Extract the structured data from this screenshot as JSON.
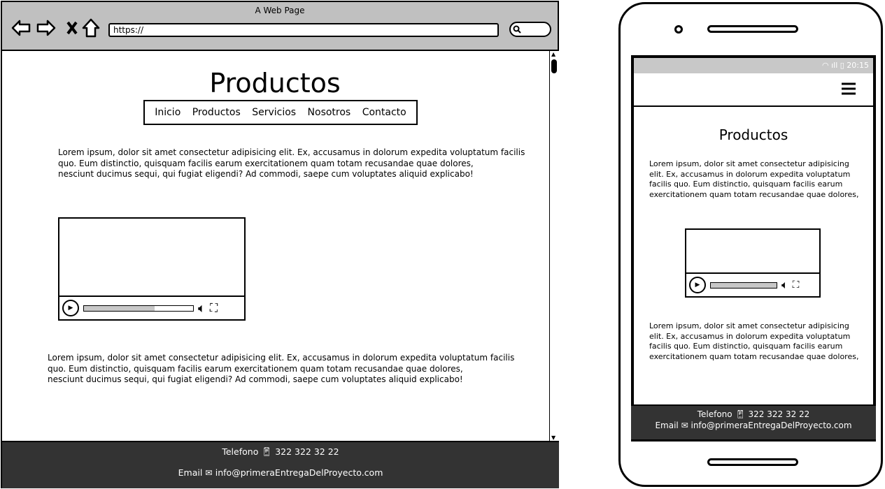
{
  "browser": {
    "title": "A Web Page",
    "url": "https://"
  },
  "page": {
    "heading": "Productos",
    "nav": [
      "Inicio",
      "Productos",
      "Servicios",
      "Nosotros",
      "Contacto"
    ],
    "paragraph1": [
      "Lorem ipsum, dolor sit amet consectetur adipisicing elit. Ex, accusamus in dolorum expedita voluptatum facilis",
      "quo. Eum distinctio, quisquam facilis earum exercitationem quam totam recusandae quae dolores,",
      "nesciunt ducimus sequi, qui fugiat eligendi? Ad commodi, saepe cum voluptates aliquid explicabo!"
    ],
    "paragraph2": [
      "Lorem ipsum, dolor sit amet consectetur adipisicing elit. Ex, accusamus in dolorum expedita voluptatum facilis",
      "quo. Eum distinctio, quisquam facilis earum exercitationem quam totam recusandae quae dolores,",
      "nesciunt ducimus sequi, qui fugiat eligendi? Ad commodi, saepe cum voluptates aliquid explicabo!"
    ],
    "video": {
      "progress": 0.65
    }
  },
  "footer": {
    "phone_label": "Telefono",
    "phone": "322 322 32 22",
    "email_label": "Email",
    "email": "info@primeraEntregaDelProyecto.com"
  },
  "mobile": {
    "time": "20:15",
    "heading": "Productos",
    "paragraph1": [
      "Lorem ipsum, dolor sit amet consectetur adipisicing",
      "elit. Ex, accusamus in dolorum expedita voluptatum",
      "facilis quo. Eum distinctio, quisquam facilis earum",
      "exercitationem quam totam recusandae quae dolores,"
    ],
    "paragraph2": [
      "Lorem ipsum, dolor sit amet consectetur adipisicing",
      "elit. Ex, accusamus in dolorum expedita voluptatum",
      "facilis quo. Eum distinctio, quisquam facilis earum",
      "exercitationem quam totam recusandae quae dolores,"
    ],
    "video": {
      "progress": 1.0
    }
  },
  "icons": {
    "back": "arrow-left-icon",
    "forward": "arrow-right-icon",
    "stop": "close-icon",
    "home": "home-icon",
    "search": "search-icon",
    "phone": "phone-icon",
    "email": "envelope-icon",
    "menu": "hamburger-icon"
  }
}
